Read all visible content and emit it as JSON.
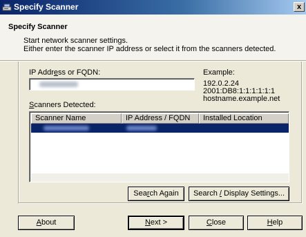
{
  "window": {
    "title": "Specify Scanner",
    "close_label": "x"
  },
  "header": {
    "heading": "Specify Scanner",
    "line1": "Start network scanner settings.",
    "line2": "Either enter the scanner IP address or select it from the scanners detected."
  },
  "form": {
    "ip_label_pre": "IP Addr",
    "ip_label_ul": "e",
    "ip_label_post": "ss or FQDN:",
    "ip_value_redacted": true,
    "example_label": "Example:",
    "example_lines": [
      "192.0.2.24",
      "2001:DB8:1:1:1:1:1:1",
      "hostname.example.net"
    ]
  },
  "scanners": {
    "label_ul": "S",
    "label_rest": "canners Detected:",
    "columns": [
      "Scanner Name",
      "IP Address / FQDN",
      "Installed Location"
    ],
    "selected_row_redacted": true
  },
  "buttons": {
    "search_again_pre": "Sea",
    "search_again_ul": "r",
    "search_again_post": "ch Again",
    "search_display_pre": "Search ",
    "search_display_ul": "/",
    "search_display_post": " Display Settings...",
    "about_ul": "A",
    "about_rest": "bout",
    "next_ul": "N",
    "next_rest": "ext >",
    "close_ul": "C",
    "close_rest": "lose",
    "help_ul": "H",
    "help_rest": "elp"
  },
  "colors": {
    "title_bar": "#0a246a",
    "selection": "#0a246a",
    "dialog_bg": "#ece9d8"
  }
}
